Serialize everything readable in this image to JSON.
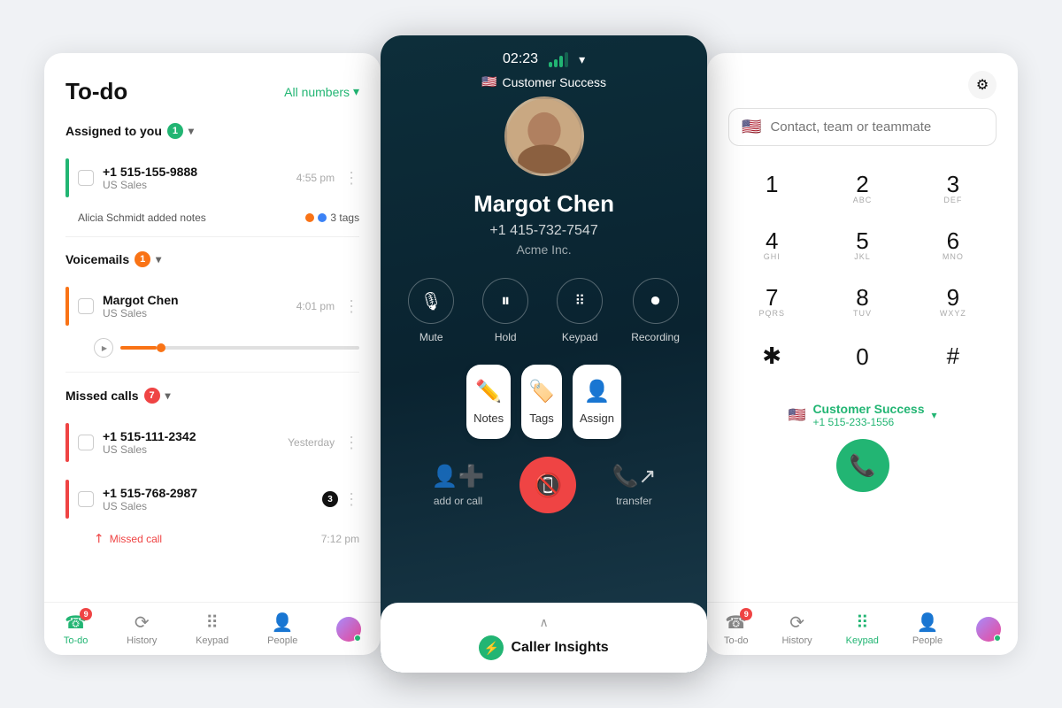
{
  "left_panel": {
    "title": "To-do",
    "filter_label": "All numbers",
    "sections": {
      "assigned": {
        "label": "Assigned to you",
        "badge": "1",
        "items": [
          {
            "number": "+1 515-155-9888",
            "team": "US Sales",
            "time": "4:55 pm",
            "border_color": "green"
          }
        ],
        "note": "Alicia Schmidt added notes",
        "tags_label": "3 tags"
      },
      "voicemails": {
        "label": "Voicemails",
        "badge": "1",
        "items": [
          {
            "name": "Margot Chen",
            "team": "US Sales",
            "time": "4:01 pm",
            "border_color": "orange"
          }
        ]
      },
      "missed_calls": {
        "label": "Missed calls",
        "badge": "7",
        "items": [
          {
            "number": "+1 515-111-2342",
            "team": "US Sales",
            "time": "Yesterday",
            "border_color": "red"
          },
          {
            "number": "+1 515-768-2987",
            "team": "US Sales",
            "time": "",
            "border_color": "red",
            "badge": "3"
          }
        ],
        "missed_call_time": "7:12 pm"
      }
    },
    "bottom_nav": [
      {
        "label": "To-do",
        "icon": "☎",
        "active": true,
        "badge": "9"
      },
      {
        "label": "History",
        "icon": "⟳",
        "active": false
      },
      {
        "label": "Keypad",
        "icon": "⠿",
        "active": false
      },
      {
        "label": "People",
        "icon": "👤",
        "active": false
      }
    ]
  },
  "center_panel": {
    "timer": "02:23",
    "team": "Customer Success",
    "caller_name": "Margot Chen",
    "phone": "+1 415-732-7547",
    "company": "Acme Inc.",
    "controls": [
      {
        "label": "Mute",
        "icon": "🎙"
      },
      {
        "label": "Hold",
        "icon": "⏸"
      },
      {
        "label": "Keypad",
        "icon": "⠿"
      },
      {
        "label": "Recording",
        "icon": "⏺"
      }
    ],
    "actions": [
      {
        "label": "Notes",
        "icon": "✏"
      },
      {
        "label": "Tags",
        "icon": "🏷"
      },
      {
        "label": "Assign",
        "icon": "👤"
      }
    ],
    "bottom_actions": [
      {
        "label": "add or call",
        "icon": "👤"
      },
      {
        "label": "transfer",
        "icon": "📞"
      }
    ],
    "insights_label": "Caller Insights"
  },
  "right_panel": {
    "search_placeholder": "Contact, team or teammate",
    "keys": [
      {
        "num": "1",
        "letters": ""
      },
      {
        "num": "2",
        "letters": "ABC"
      },
      {
        "num": "3",
        "letters": "DEF"
      },
      {
        "num": "4",
        "letters": "GHI"
      },
      {
        "num": "5",
        "letters": "JKL"
      },
      {
        "num": "6",
        "letters": "MNO"
      },
      {
        "num": "7",
        "letters": "PQRS"
      },
      {
        "num": "8",
        "letters": "TUV"
      },
      {
        "num": "9",
        "letters": "WXYZ"
      },
      {
        "num": "*",
        "letters": ""
      },
      {
        "num": "0",
        "letters": ""
      },
      {
        "num": "#",
        "letters": ""
      }
    ],
    "active_number_name": "Customer Success",
    "active_number": "+1 515-233-1556",
    "bottom_nav": [
      {
        "label": "To-do",
        "icon": "☎",
        "active": false,
        "badge": "9"
      },
      {
        "label": "History",
        "icon": "⟳",
        "active": false
      },
      {
        "label": "Keypad",
        "icon": "⠿",
        "active": true
      },
      {
        "label": "People",
        "icon": "👤",
        "active": false
      }
    ]
  },
  "colors": {
    "green": "#22b573",
    "orange": "#f97316",
    "red": "#ef4444",
    "dark_bg": "#0d2e3a"
  }
}
